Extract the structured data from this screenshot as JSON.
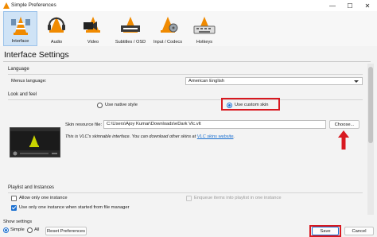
{
  "window": {
    "title": "Simple Preferences",
    "minimize_glyph": "—",
    "maximize_glyph": "☐",
    "close_glyph": "✕"
  },
  "tabs": [
    {
      "label": "Interface",
      "icon": "interface-icon",
      "active": true
    },
    {
      "label": "Audio",
      "icon": "audio-icon",
      "active": false
    },
    {
      "label": "Video",
      "icon": "video-icon",
      "active": false
    },
    {
      "label": "Subtitles / OSD",
      "icon": "subtitles-icon",
      "active": false
    },
    {
      "label": "Input / Codecs",
      "icon": "input-codecs-icon",
      "active": false
    },
    {
      "label": "Hotkeys",
      "icon": "hotkeys-icon",
      "active": false
    }
  ],
  "page_title": "Interface Settings",
  "language": {
    "section": "Language",
    "menus_label": "Menus language:",
    "menus_value": "American English"
  },
  "look": {
    "section": "Look and feel",
    "native_label": "Use native style",
    "custom_label": "Use custom skin",
    "custom_selected": true,
    "skin_label": "Skin resource file:",
    "skin_value": "C:\\Users\\Ajoy Kumar\\Downloads\\eDark Vlc.vlt",
    "choose_label": "Choose...",
    "info_text": "This is VLC's skinnable interface. You can download other skins at ",
    "info_link": "VLC skins website",
    "info_end": "."
  },
  "playlist": {
    "section": "Playlist and Instances",
    "opt1": "Allow only one instance",
    "opt2": "Use only one instance when started from file manager",
    "opt3": "Enqueue items into playlist in one instance",
    "opt1_checked": false,
    "opt2_checked": true
  },
  "footer": {
    "show_settings": "Show settings",
    "simple": "Simple",
    "all": "All",
    "reset": "Reset Preferences",
    "save": "Save",
    "cancel": "Cancel"
  },
  "colors": {
    "highlight": "#d81920",
    "accent": "#1a6fd0",
    "active_tab": "#cfe3f6"
  }
}
